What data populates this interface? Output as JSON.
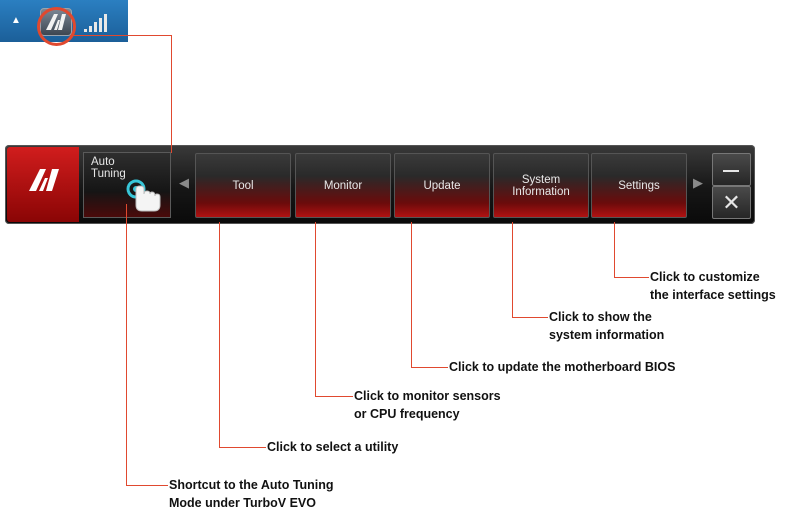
{
  "tray": {
    "icons": [
      "expand-arrow-icon",
      "ai-suite-tray-icon",
      "network-signal-icon"
    ]
  },
  "toolbar": {
    "logo_icon": "ai-suite-logo-icon",
    "auto_tuning_label": "Auto\nTuning",
    "tabs": [
      {
        "label": "Tool"
      },
      {
        "label": "Monitor"
      },
      {
        "label": "Update"
      },
      {
        "label": "System\nInformation"
      },
      {
        "label": "Settings"
      }
    ],
    "minimize_icon": "minimize-icon",
    "close_label": "✕"
  },
  "callouts": {
    "settings": "Click to customize\nthe interface settings",
    "system_information": "Click to show the\nsystem information",
    "update": "Click to update the motherboard BIOS",
    "monitor": "Click to monitor sensors\nor CPU frequency",
    "tool": "Click to select a utility",
    "auto_tuning": "Shortcut to the Auto Tuning\nMode under TurboV EVO"
  },
  "colors": {
    "callout_line": "#e0492f",
    "tab_red": "#b01212",
    "tray_blue": "#1f6fb0"
  }
}
